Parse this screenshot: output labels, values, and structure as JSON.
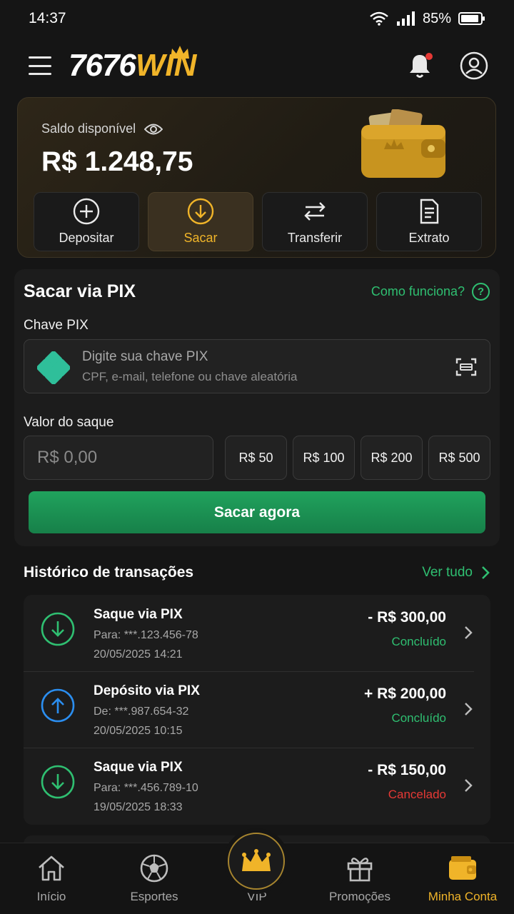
{
  "status_bar": {
    "time": "14:37",
    "battery": "85%"
  },
  "header": {
    "logo_number": "7676",
    "logo_word": "WIN"
  },
  "balance": {
    "label": "Saldo disponível",
    "amount": "R$ 1.248,75",
    "actions": [
      {
        "label": "Depositar",
        "icon": "plus-circle-icon"
      },
      {
        "label": "Sacar",
        "icon": "download-circle-icon",
        "active": true
      },
      {
        "label": "Transferir",
        "icon": "transfer-arrows-icon"
      },
      {
        "label": "Extrato",
        "icon": "document-icon"
      }
    ]
  },
  "pix": {
    "title": "Sacar via PIX",
    "help_link": "Como funciona?",
    "key_label": "Chave PIX",
    "key_placeholder": "Digite sua chave PIX",
    "key_hint": "CPF, e-mail, telefone ou chave aleatória",
    "amount_label": "Valor do saque",
    "amount_placeholder": "R$ 0,00",
    "quick_amounts": [
      "R$ 50",
      "R$ 100",
      "R$ 200",
      "R$ 500"
    ],
    "submit": "Sacar agora"
  },
  "history": {
    "title": "Histórico de transações",
    "see_all": "Ver tudo",
    "items": [
      {
        "title": "Saque via PIX",
        "party": "Para: ***.123.456-78",
        "date": "20/05/2025 14:21",
        "amount": "- R$ 300,00",
        "status": "Concluído",
        "status_color": "#2fbf71",
        "direction": "down"
      },
      {
        "title": "Depósito via PIX",
        "party": "De: ***.987.654-32",
        "date": "20/05/2025 10:15",
        "amount": "+ R$ 200,00",
        "status": "Concluído",
        "status_color": "#2fbf71",
        "direction": "up"
      },
      {
        "title": "Saque via PIX",
        "party": "Para: ***.456.789-10",
        "date": "19/05/2025 18:33",
        "amount": "- R$ 150,00",
        "status": "Cancelado",
        "status_color": "#e53935",
        "direction": "down"
      }
    ]
  },
  "nav": {
    "items": [
      {
        "label": "Início",
        "icon": "home-icon"
      },
      {
        "label": "Esportes",
        "icon": "soccer-ball-icon"
      },
      {
        "label": "VIP",
        "icon": "crown-icon"
      },
      {
        "label": "Promoções",
        "icon": "gift-icon"
      },
      {
        "label": "Minha Conta",
        "icon": "wallet-icon",
        "active": true
      }
    ]
  },
  "colors": {
    "accent_gold": "#f0b429",
    "accent_green": "#2fbf71",
    "danger": "#e53935",
    "blue": "#2b8ef0"
  }
}
